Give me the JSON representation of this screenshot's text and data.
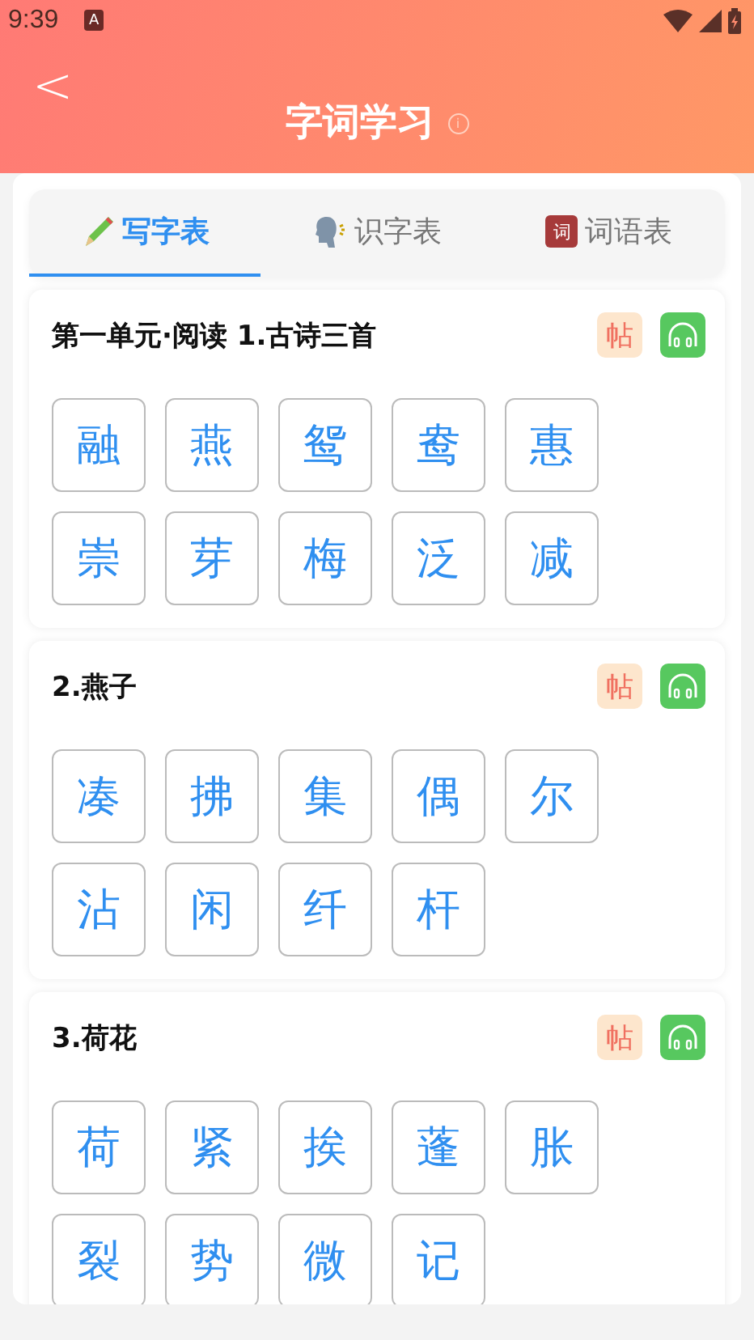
{
  "status_bar": {
    "time": "9:39",
    "notification": "A"
  },
  "header": {
    "back": "<",
    "title": "字词学习",
    "info": "i"
  },
  "tabs": [
    {
      "label": "写字表",
      "kind": "pencil",
      "selected": true
    },
    {
      "label": "识字表",
      "kind": "speaker",
      "selected": false
    },
    {
      "label": "词语表",
      "kind": "book",
      "icon_text": "词",
      "selected": false
    }
  ],
  "sections": [
    {
      "title": "第一单元·阅读 1.古诗三首",
      "badge": "帖",
      "chars": [
        "融",
        "燕",
        "鸳",
        "鸯",
        "惠",
        "崇",
        "芽",
        "梅",
        "泛",
        "减"
      ]
    },
    {
      "title": "2.燕子",
      "badge": "帖",
      "chars": [
        "凑",
        "拂",
        "集",
        "偶",
        "尔",
        "沾",
        "闲",
        "纤",
        "杆"
      ]
    },
    {
      "title": "3.荷花",
      "badge": "帖",
      "chars": [
        "荷",
        "紧",
        "挨",
        "蓬",
        "胀",
        "裂",
        "势",
        "微",
        "记"
      ]
    }
  ]
}
